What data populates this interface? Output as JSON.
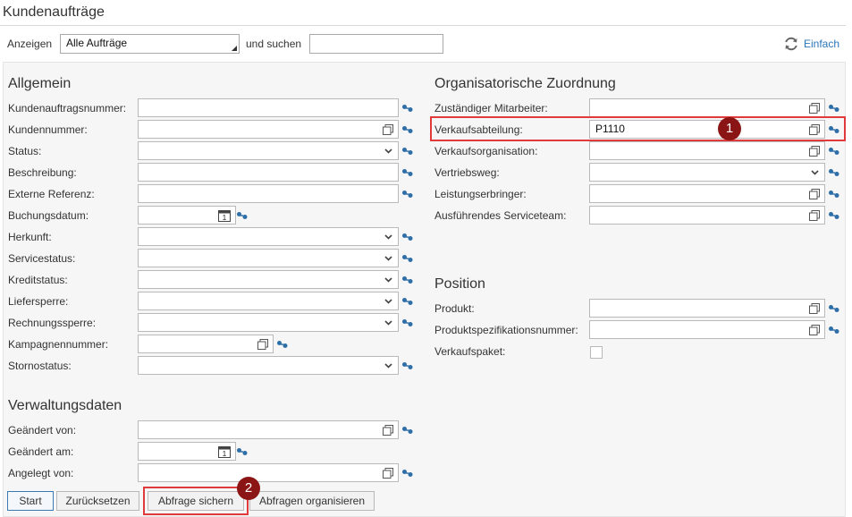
{
  "page": {
    "title": "Kundenaufträge"
  },
  "toolbar": {
    "show_label": "Anzeigen",
    "show_select": "Alle Aufträge",
    "search_label": "und suchen",
    "search_value": "",
    "simple_link": "Einfach"
  },
  "general": {
    "heading": "Allgemein",
    "fields": [
      {
        "label": "Kundenauftragsnummer:",
        "value": ""
      },
      {
        "label": "Kundennummer:",
        "value": ""
      },
      {
        "label": "Status:",
        "value": ""
      },
      {
        "label": "Beschreibung:",
        "value": ""
      },
      {
        "label": "Externe Referenz:",
        "value": ""
      },
      {
        "label": "Buchungsdatum:",
        "value": ""
      },
      {
        "label": "Herkunft:",
        "value": ""
      },
      {
        "label": "Servicestatus:",
        "value": ""
      },
      {
        "label": "Kreditstatus:",
        "value": ""
      },
      {
        "label": "Liefersperre:",
        "value": ""
      },
      {
        "label": "Rechnungssperre:",
        "value": ""
      },
      {
        "label": "Kampagnennummer:",
        "value": ""
      },
      {
        "label": "Stornostatus:",
        "value": ""
      }
    ]
  },
  "admin": {
    "heading": "Verwaltungsdaten",
    "fields": [
      {
        "label": "Geändert von:",
        "value": ""
      },
      {
        "label": "Geändert am:",
        "value": ""
      },
      {
        "label": "Angelegt von:",
        "value": ""
      }
    ]
  },
  "org": {
    "heading": "Organisatorische Zuordnung",
    "fields": [
      {
        "label": "Zuständiger Mitarbeiter:",
        "value": ""
      },
      {
        "label": "Verkaufsabteilung:",
        "value": "P1110"
      },
      {
        "label": "Verkaufsorganisation:",
        "value": ""
      },
      {
        "label": "Vertriebsweg:",
        "value": ""
      },
      {
        "label": "Leistungserbringer:",
        "value": ""
      },
      {
        "label": "Ausführendes Serviceteam:",
        "value": ""
      }
    ]
  },
  "position": {
    "heading": "Position",
    "fields": [
      {
        "label": "Produkt:",
        "value": ""
      },
      {
        "label": "Produktspezifikationsnummer:",
        "value": ""
      },
      {
        "label": "Verkaufspaket:",
        "value": ""
      }
    ]
  },
  "buttons": {
    "start": "Start",
    "reset": "Zurücksetzen",
    "save_query": "Abfrage sichern",
    "organize": "Abfragen organisieren"
  },
  "callouts": {
    "one": "1",
    "two": "2"
  },
  "colors": {
    "highlight": "#e03a3a",
    "badge": "#8b1414",
    "link": "#2a76b8"
  }
}
